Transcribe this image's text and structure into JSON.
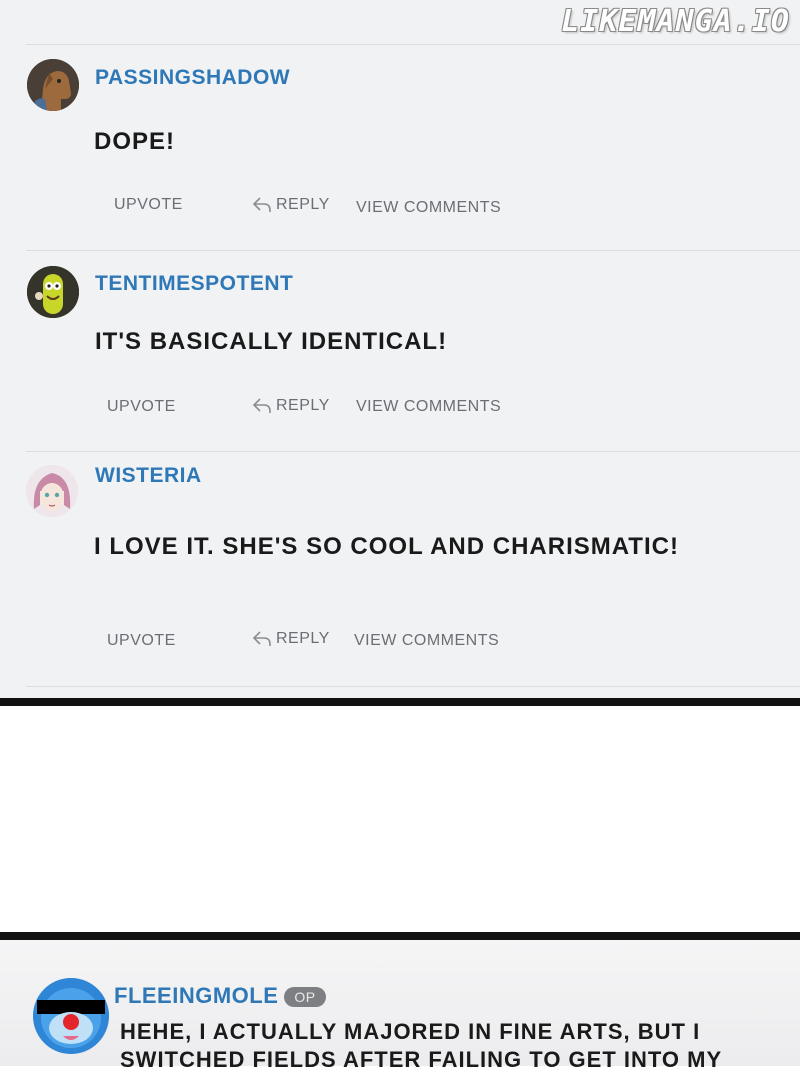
{
  "watermark": "LIKEMANGA.IO",
  "comments": [
    {
      "username": "PASSINGSHADOW",
      "text": "DOPE!",
      "actions": {
        "upvote": "UPVOTE",
        "reply": "REPLY",
        "view": "VIEW COMMENTS"
      }
    },
    {
      "username": "TENTIMESPOTENT",
      "text": "IT'S BASICALLY IDENTICAL!",
      "actions": {
        "upvote": "UPVOTE",
        "reply": "REPLY",
        "view": "VIEW COMMENTS"
      }
    },
    {
      "username": "WISTERIA",
      "text": "I LOVE IT. SHE'S SO COOL AND CHARISMATIC!",
      "actions": {
        "upvote": "UPVOTE",
        "reply": "REPLY",
        "view": "VIEW COMMENTS"
      }
    }
  ],
  "op_comment": {
    "username": "FLEEINGMOLE",
    "badge": "OP",
    "line1": "HEHE, I ACTUALLY MAJORED IN FINE ARTS, BUT I",
    "line2": "SWITCHED FIELDS AFTER FAILING TO GET INTO MY"
  },
  "colors": {
    "username": "#2f78b7",
    "panel": "#f1f2f4",
    "bar": "#111111"
  }
}
